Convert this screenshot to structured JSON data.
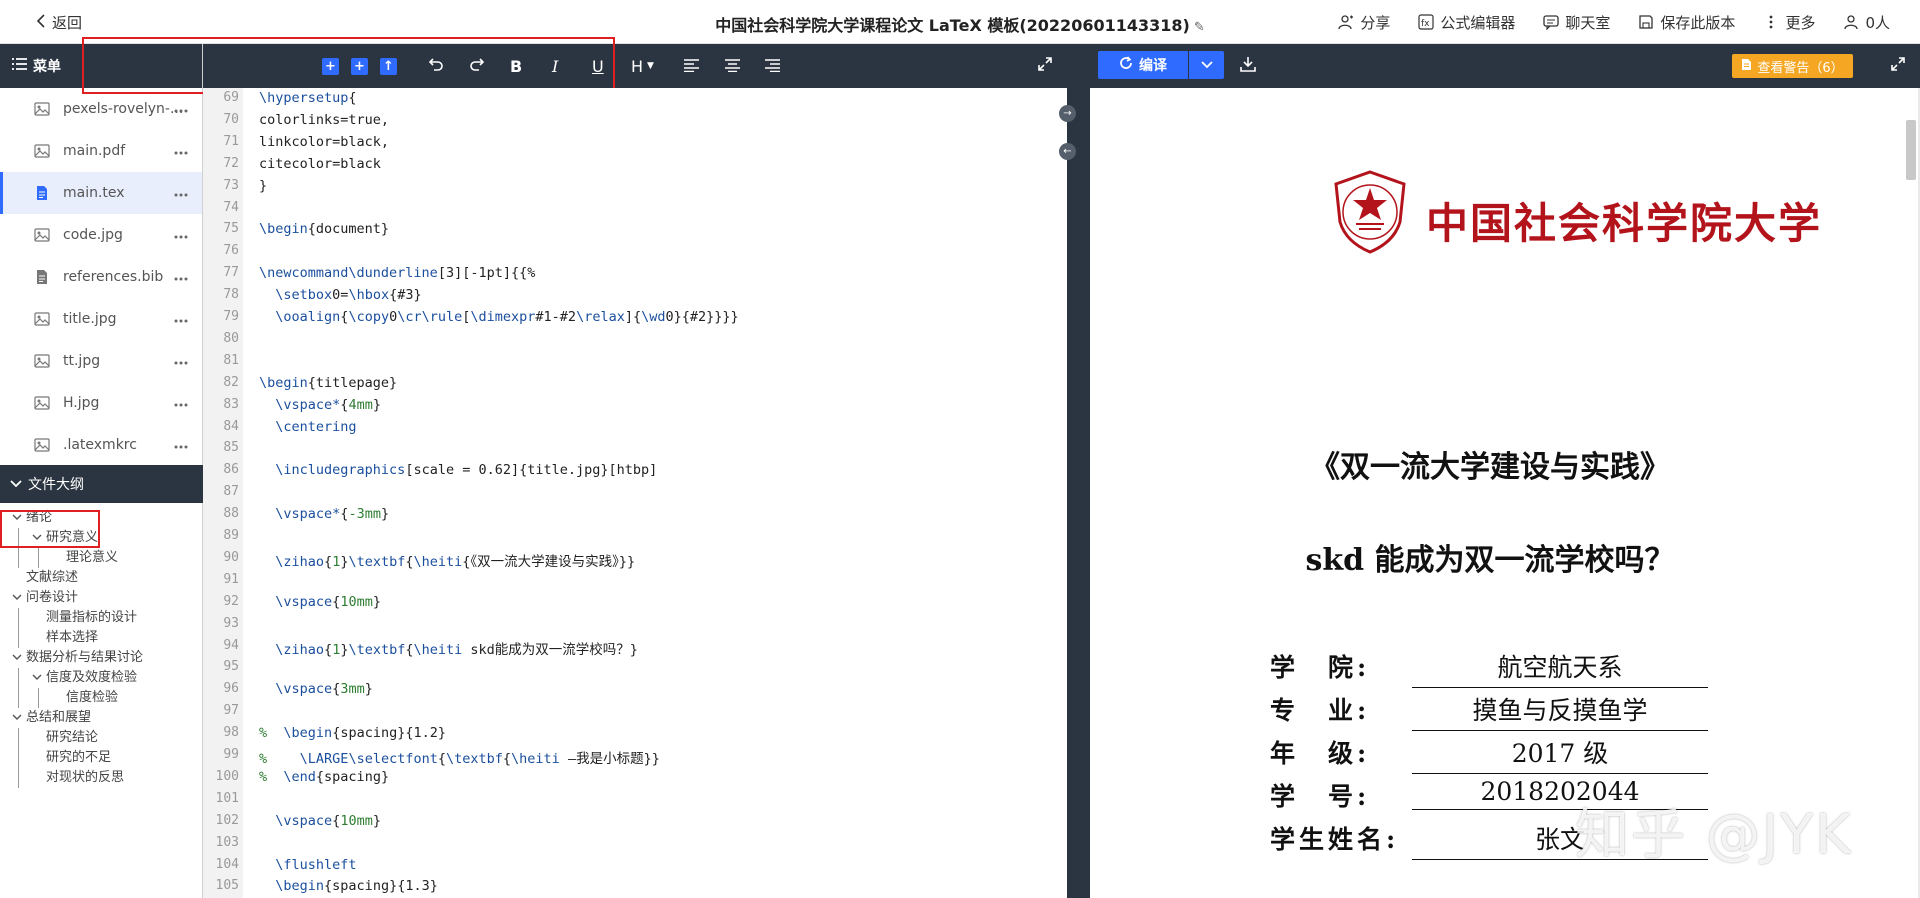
{
  "header": {
    "back_label": "返回",
    "title": "中国社会科学院大学课程论文 LaTeX 模板(20220601143318)",
    "share_label": "分享",
    "formula_label": "公式编辑器",
    "chat_label": "聊天室",
    "save_version_label": "保存此版本",
    "more_label": "更多",
    "people_label": "0人"
  },
  "sidebar": {
    "menu_label": "菜单",
    "files": [
      {
        "name": "pexels-rovelyn-...",
        "type": "image"
      },
      {
        "name": "main.pdf",
        "type": "image"
      },
      {
        "name": "main.tex",
        "type": "doc"
      },
      {
        "name": "code.jpg",
        "type": "image"
      },
      {
        "name": "references.bib",
        "type": "doc"
      },
      {
        "name": "title.jpg",
        "type": "image"
      },
      {
        "name": "tt.jpg",
        "type": "image"
      },
      {
        "name": "H.jpg",
        "type": "image"
      },
      {
        "name": ".latexmkrc",
        "type": "image"
      }
    ],
    "outline_label": "文件大纲",
    "outline": [
      {
        "text": "绪论",
        "level": 0,
        "chev": true
      },
      {
        "text": "研究意义",
        "level": 1,
        "chev": true
      },
      {
        "text": "理论意义",
        "level": 2,
        "chev": false
      },
      {
        "text": "文献综述",
        "level": 0,
        "chev": false
      },
      {
        "text": "问卷设计",
        "level": 0,
        "chev": true
      },
      {
        "text": "测量指标的设计",
        "level": 1,
        "chev": false
      },
      {
        "text": "样本选择",
        "level": 1,
        "chev": false
      },
      {
        "text": "数据分析与结果讨论",
        "level": 0,
        "chev": true
      },
      {
        "text": "信度及效度检验",
        "level": 1,
        "chev": true
      },
      {
        "text": "信度检验",
        "level": 2,
        "chev": false
      },
      {
        "text": "总结和展望",
        "level": 0,
        "chev": true
      },
      {
        "text": "研究结论",
        "level": 1,
        "chev": false
      },
      {
        "text": "研究的不足",
        "level": 1,
        "chev": false
      },
      {
        "text": "对现状的反思",
        "level": 1,
        "chev": false
      }
    ]
  },
  "toolbar": {
    "heading_label": "H",
    "bold_label": "B",
    "italic_label": "I",
    "underline_label": "U"
  },
  "editor": {
    "lines": [
      {
        "n": "69",
        "text": "\\hypersetup{"
      },
      {
        "n": "70",
        "text": "colorlinks=true,"
      },
      {
        "n": "71",
        "text": "linkcolor=black,"
      },
      {
        "n": "72",
        "text": "citecolor=black"
      },
      {
        "n": "73",
        "text": "}"
      },
      {
        "n": "74",
        "text": ""
      },
      {
        "n": "75",
        "text": "\\begin{document}"
      },
      {
        "n": "76",
        "text": ""
      },
      {
        "n": "77",
        "text": "\\newcommand\\dunderline[3][-1pt]{{%"
      },
      {
        "n": "78",
        "text": "  \\setbox0=\\hbox{#3}"
      },
      {
        "n": "79",
        "text": "  \\ooalign{\\copy0\\cr\\rule[\\dimexpr#1-#2\\relax]{\\wd0}{#2}}}}"
      },
      {
        "n": "80",
        "text": ""
      },
      {
        "n": "81",
        "text": ""
      },
      {
        "n": "82",
        "text": "\\begin{titlepage}"
      },
      {
        "n": "83",
        "text": "  \\vspace*{4mm}"
      },
      {
        "n": "84",
        "text": "  \\centering"
      },
      {
        "n": "85",
        "text": ""
      },
      {
        "n": "86",
        "text": "  \\includegraphics[scale = 0.62]{title.jpg}[htbp]"
      },
      {
        "n": "87",
        "text": ""
      },
      {
        "n": "88",
        "text": "  \\vspace*{-3mm}"
      },
      {
        "n": "89",
        "text": ""
      },
      {
        "n": "90",
        "text": "  \\zihao{1}\\textbf{\\heiti{《双一流大学建设与实践》}}"
      },
      {
        "n": "91",
        "text": ""
      },
      {
        "n": "92",
        "text": "  \\vspace{10mm}"
      },
      {
        "n": "93",
        "text": ""
      },
      {
        "n": "94",
        "text": "  \\zihao{1}\\textbf{\\heiti skd能成为双一流学校吗？}"
      },
      {
        "n": "95",
        "text": ""
      },
      {
        "n": "96",
        "text": "  \\vspace{3mm}"
      },
      {
        "n": "97",
        "text": ""
      },
      {
        "n": "98",
        "text": "%  \\begin{spacing}{1.2}"
      },
      {
        "n": "99",
        "text": "%    \\LARGE\\selectfont{\\textbf{\\heiti —我是小标题}}"
      },
      {
        "n": "100",
        "text": "%  \\end{spacing}"
      },
      {
        "n": "101",
        "text": ""
      },
      {
        "n": "102",
        "text": "  \\vspace{10mm}"
      },
      {
        "n": "103",
        "text": ""
      },
      {
        "n": "104",
        "text": "  \\flushleft"
      },
      {
        "n": "105",
        "text": "  \\begin{spacing}{1.3}"
      }
    ]
  },
  "preview": {
    "compile_label": "编译",
    "warning_label": "查看警告（6）",
    "university_name": "中国社会科学院大学",
    "title_line": "《双一流大学建设与实践》",
    "subtitle_line": "skd 能成为双一流学校吗？",
    "fields": [
      {
        "label": "学　院:",
        "value": "航空航天系"
      },
      {
        "label": "专　业:",
        "value": "摸鱼与反摸鱼学"
      },
      {
        "label": "年　级:",
        "value": "2017 级"
      },
      {
        "label": "学　号:",
        "value": "2018202044"
      },
      {
        "label": "学生姓名:",
        "value": "张文"
      }
    ],
    "watermark": "知乎 @JYK"
  },
  "colors": {
    "toolbar_bg": "#2b3541",
    "accent": "#2f6bff",
    "warning": "#f5a623",
    "highlight_box": "#e02020"
  }
}
